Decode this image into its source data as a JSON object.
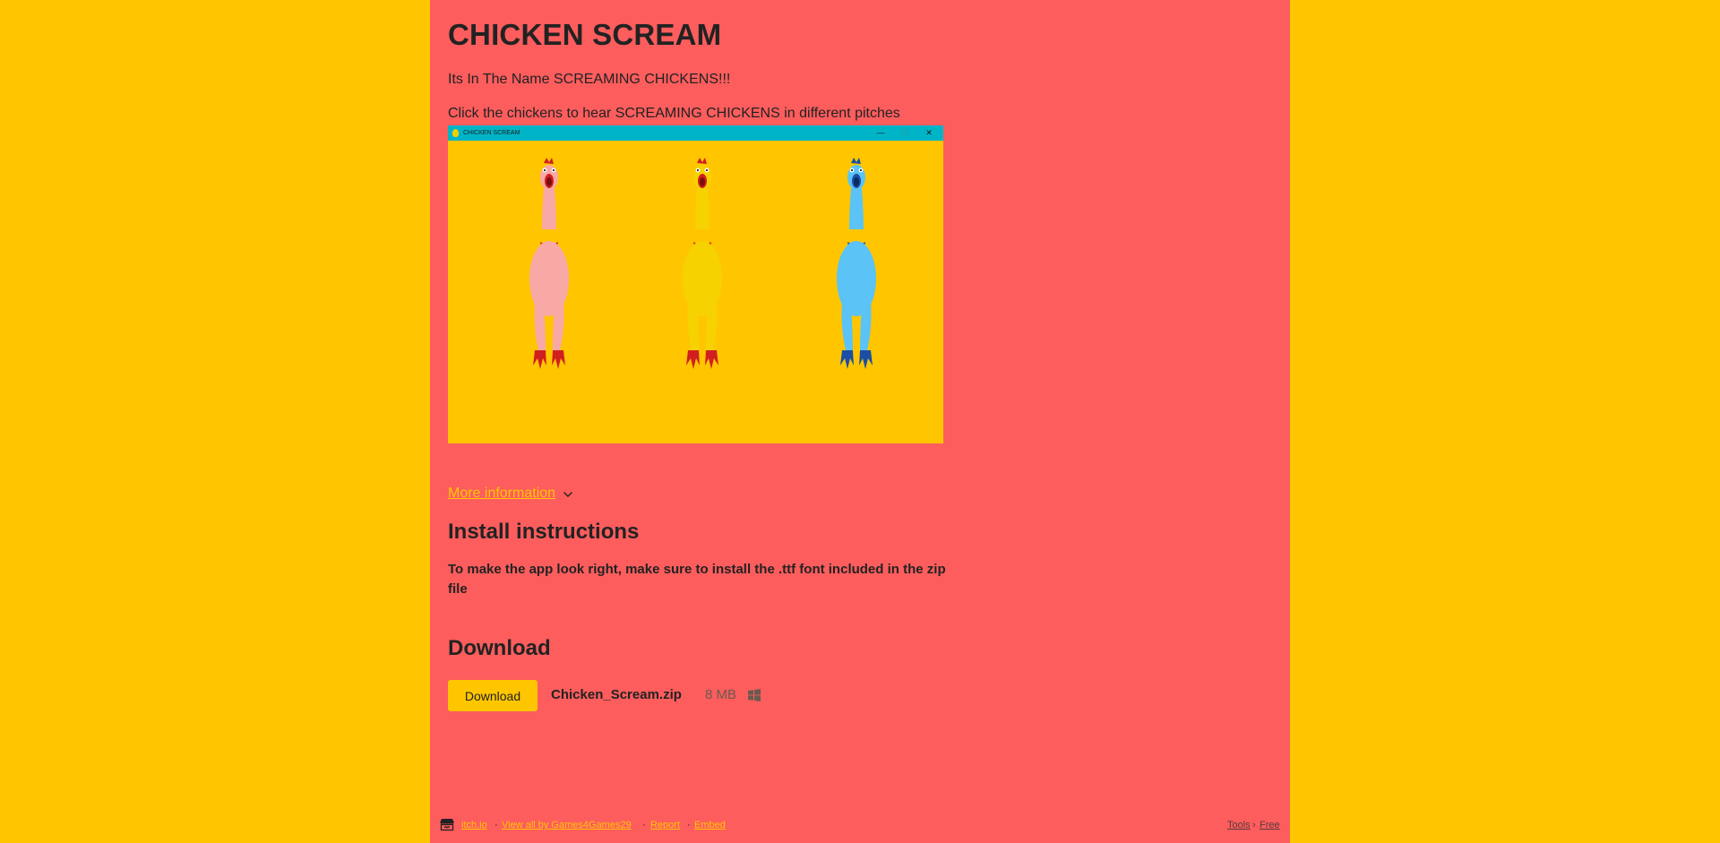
{
  "page": {
    "title": "CHICKEN SCREAM",
    "description_lines": [
      "Its In The Name SCREAMING CHICKENS!!!",
      "Click the chickens to hear SCREAMING CHICKENS in different pitches"
    ]
  },
  "screenshot": {
    "window_title": "CHICKEN SCREAM",
    "controls": {
      "minimize": "—",
      "maximize": "☐",
      "close": "✕"
    },
    "chickens": [
      {
        "color": "pink",
        "body": "#f8a9a6",
        "feet": "#d11f1f"
      },
      {
        "color": "yellow",
        "body": "#f6d200",
        "feet": "#d11f1f"
      },
      {
        "color": "blue",
        "body": "#5bc3f5",
        "feet": "#1a4fa3"
      }
    ]
  },
  "more_info": {
    "label": "More information"
  },
  "install": {
    "heading": "Install instructions",
    "text": " To make the app look right, make sure to install the .ttf font included in the zip file"
  },
  "download": {
    "heading": "Download",
    "button_label": "Download",
    "file_name": "Chicken_Scream.zip",
    "file_size": "8 MB",
    "platform_icon": "windows-icon"
  },
  "footer": {
    "itchio": "itch.io",
    "view_all": "View all by Games4Games29",
    "report": "Report",
    "embed": "Embed",
    "tools": "Tools",
    "tools_separator": "›",
    "free": "Free",
    "separator": "·"
  },
  "colors": {
    "background": "#ffc600",
    "page_column": "#fd5d5d",
    "link": "#ffc600",
    "text": "#222222",
    "titlebar": "#00b4c8"
  }
}
